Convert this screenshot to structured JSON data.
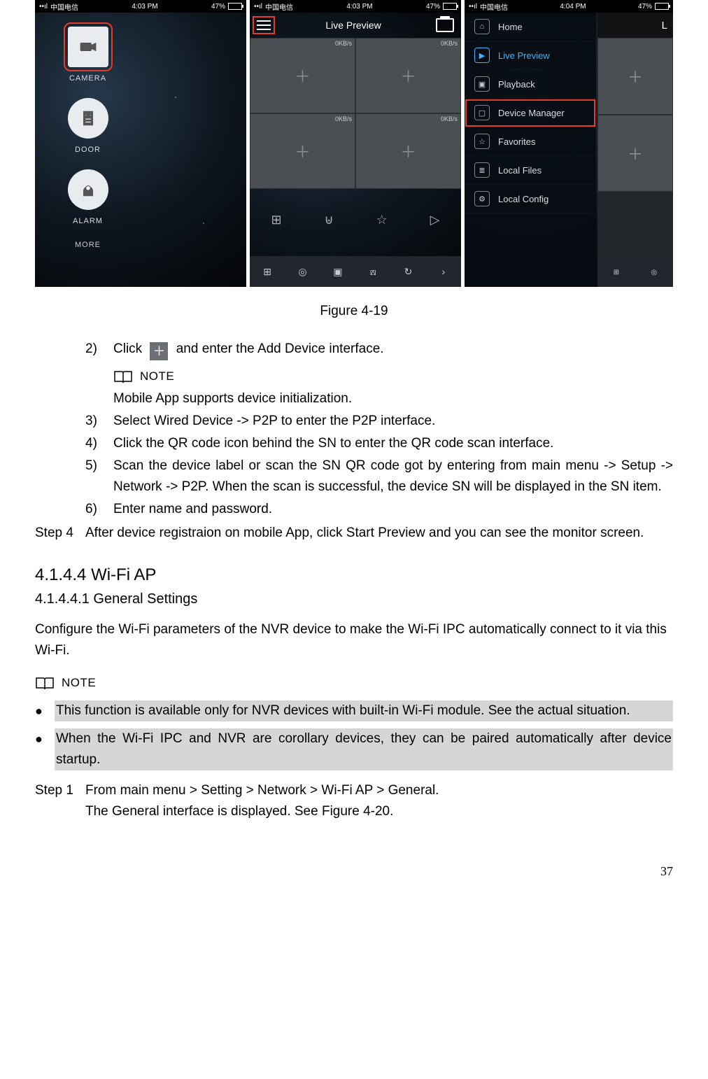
{
  "figure_caption": "Figure 4-19",
  "phone": {
    "carrier": "中国电信",
    "battery": "47%"
  },
  "screen1": {
    "time": "4:03 PM",
    "tiles": {
      "camera": "CAMERA",
      "door": "DOOR",
      "alarm": "ALARM",
      "more": "MORE"
    }
  },
  "screen2": {
    "time": "4:03 PM",
    "title": "Live Preview",
    "bitrate": "0KB/s"
  },
  "screen3": {
    "time": "4:04 PM",
    "title_letter": "L",
    "menu": {
      "home": "Home",
      "live": "Live Preview",
      "playback": "Playback",
      "device_manager": "Device Manager",
      "favorites": "Favorites",
      "local_files": "Local Files",
      "local_config": "Local Config"
    }
  },
  "steps": {
    "s2_num": "2)",
    "s2a": "Click",
    "s2b": "and enter the Add Device interface.",
    "note_label": "NOTE",
    "s2_note": "Mobile App supports device initialization.",
    "s3_num": "3)",
    "s3": "Select Wired Device -> P2P to enter the P2P interface.",
    "s4_num": "4)",
    "s4": "Click the QR code icon behind the SN to enter the QR code scan interface.",
    "s5_num": "5)",
    "s5": "Scan the device label or scan the SN QR code got by entering from main menu -> Setup -> Network -> P2P. When the scan is successful, the device SN will be displayed in the SN item.",
    "s6_num": "6)",
    "s6": "Enter name and password.",
    "step4_label": "Step 4",
    "step4_text": "After device registraion on mobile App, click Start Preview and you can see the monitor screen."
  },
  "section": {
    "h3": "4.1.4.4  Wi-Fi AP",
    "h4": "4.1.4.4.1   General Settings",
    "p1": "Configure the Wi-Fi parameters of the NVR device to make the Wi-Fi IPC automatically connect to it via this Wi-Fi.",
    "note_label": "NOTE",
    "b1": "This function is available only for NVR devices with built-in Wi-Fi module. See the actual situation.",
    "b2": "When the Wi-Fi IPC and NVR are corollary devices, they can be paired automatically after device startup.",
    "step1_label": "Step 1",
    "step1_l1": "From main menu > Setting > Network > Wi-Fi AP > General.",
    "step1_l2": "The General interface is displayed. See Figure 4-20."
  },
  "page_number": "37"
}
